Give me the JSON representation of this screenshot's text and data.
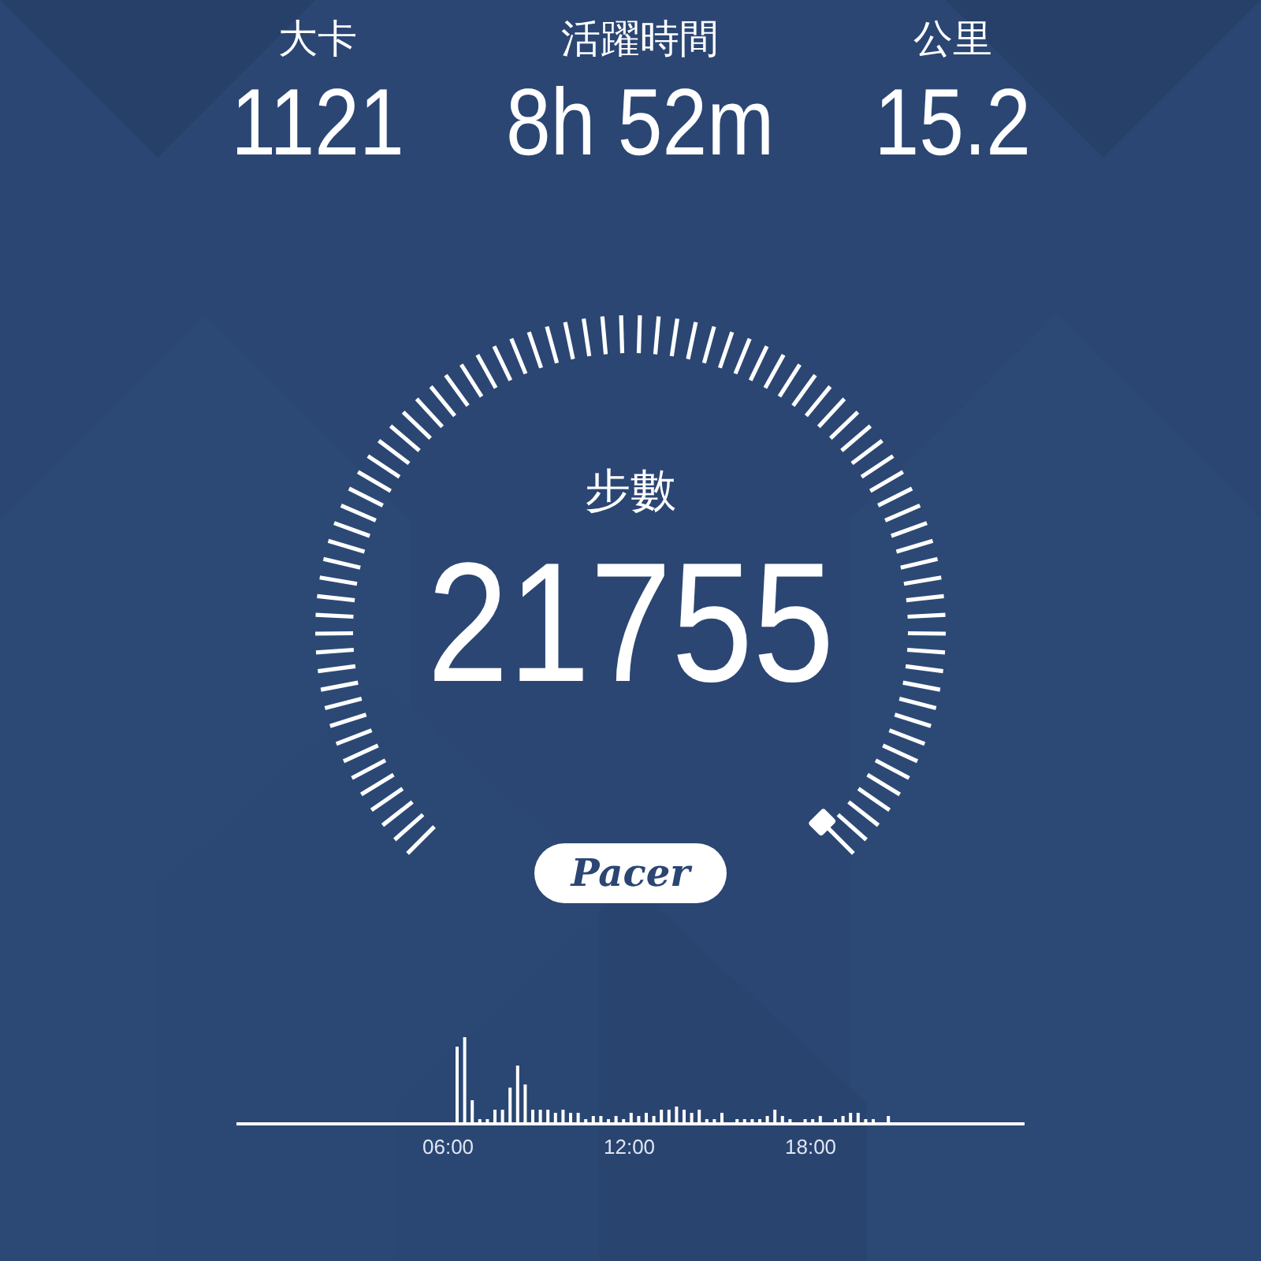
{
  "stats": [
    {
      "label": "大卡",
      "value": "1121"
    },
    {
      "label": "活躍時間",
      "value": "8h 52m"
    },
    {
      "label": "公里",
      "value": "15.2"
    }
  ],
  "gauge": {
    "label": "步數",
    "value": "21755"
  },
  "logo": "Pacer",
  "chart": {
    "x_labels": [
      "06:00",
      "12:00",
      "18:00"
    ]
  }
}
